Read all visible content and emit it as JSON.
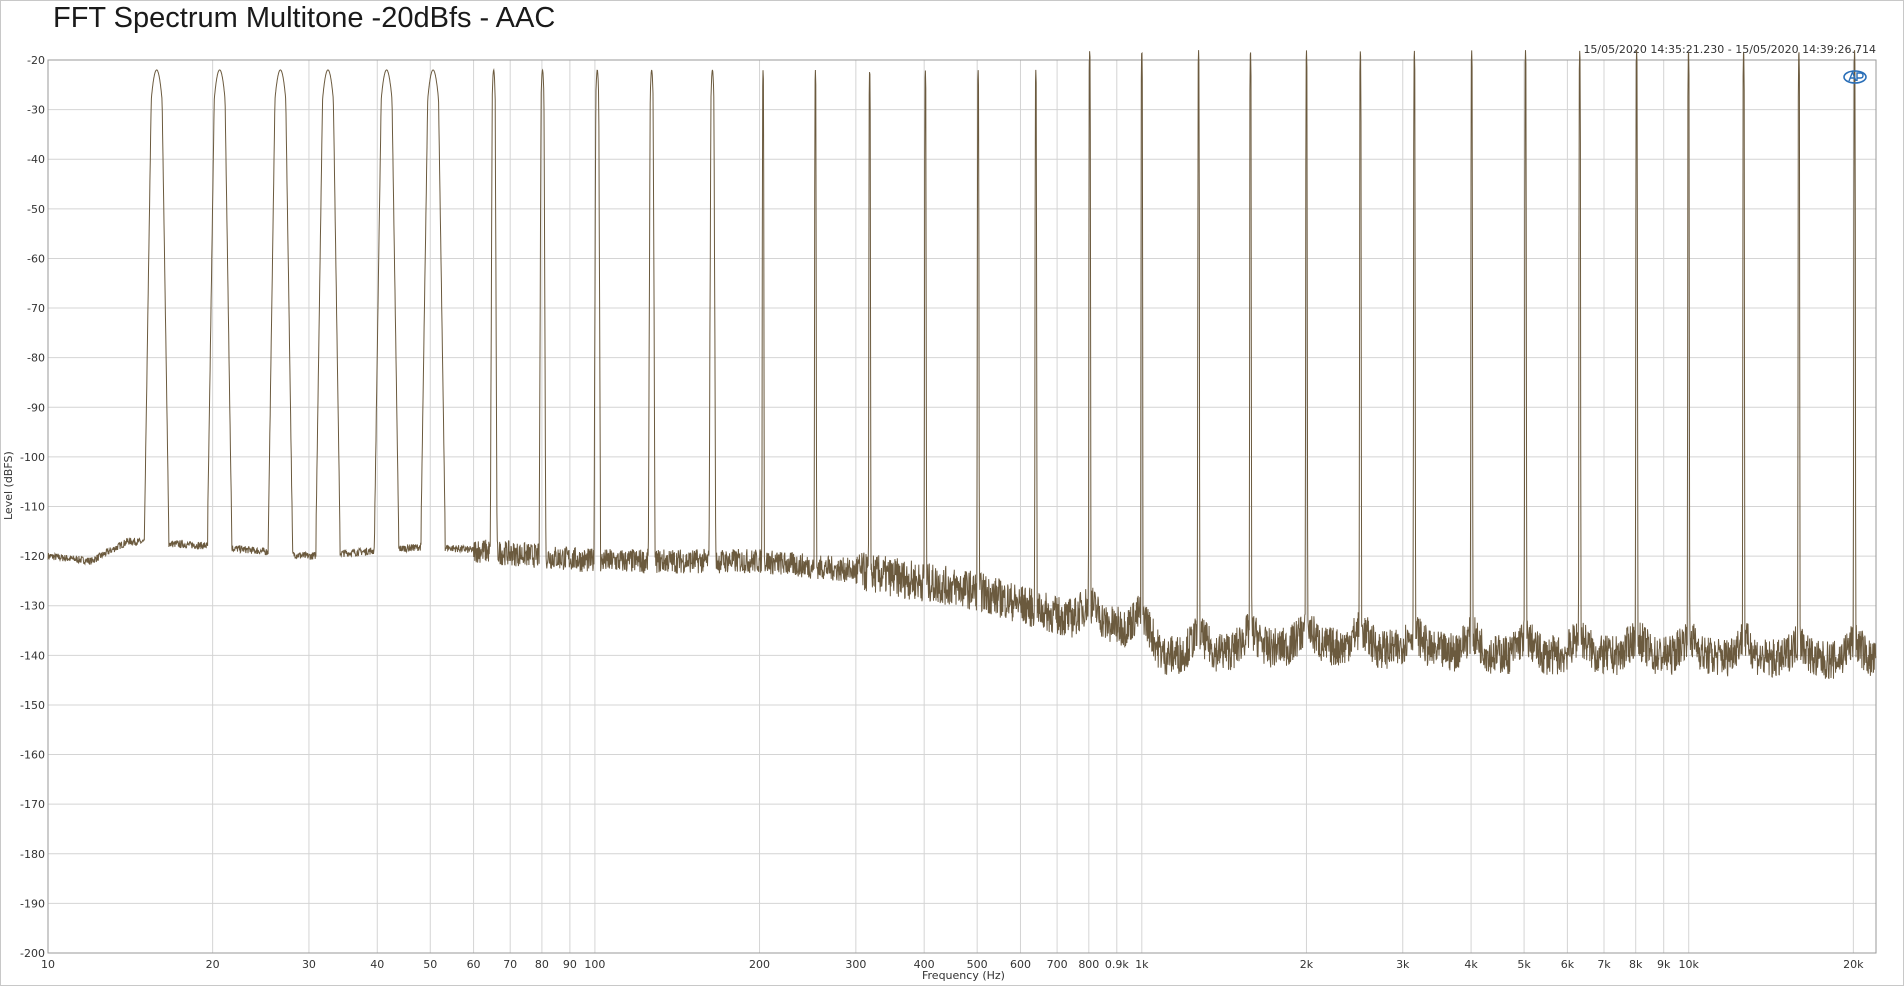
{
  "chart_data": {
    "type": "line",
    "title": "FFT Spectrum Multitone -20dBfs - AAC",
    "timestamp": "15/05/2020 14:35:21.230 - 15/05/2020 14:39:26.714",
    "xlabel": "Frequency (Hz)",
    "ylabel": "Level (dBFS)",
    "xscale": "log",
    "xlim": [
      10,
      22000
    ],
    "ylim": [
      -200,
      -20
    ],
    "grid": true,
    "line_color": "#6b5a3e",
    "x_ticks": [
      {
        "v": 10,
        "label": "10"
      },
      {
        "v": 20,
        "label": "20"
      },
      {
        "v": 30,
        "label": "30"
      },
      {
        "v": 40,
        "label": "40"
      },
      {
        "v": 50,
        "label": "50"
      },
      {
        "v": 60,
        "label": "60"
      },
      {
        "v": 70,
        "label": "70"
      },
      {
        "v": 80,
        "label": "80"
      },
      {
        "v": 90,
        "label": "90"
      },
      {
        "v": 100,
        "label": "100"
      },
      {
        "v": 200,
        "label": "200"
      },
      {
        "v": 300,
        "label": "300"
      },
      {
        "v": 400,
        "label": "400"
      },
      {
        "v": 500,
        "label": "500"
      },
      {
        "v": 600,
        "label": "600"
      },
      {
        "v": 700,
        "label": "700"
      },
      {
        "v": 800,
        "label": "800"
      },
      {
        "v": 900,
        "label": "0.9k"
      },
      {
        "v": 1000,
        "label": "1k"
      },
      {
        "v": 2000,
        "label": "2k"
      },
      {
        "v": 3000,
        "label": "3k"
      },
      {
        "v": 4000,
        "label": "4k"
      },
      {
        "v": 5000,
        "label": "5k"
      },
      {
        "v": 6000,
        "label": "6k"
      },
      {
        "v": 7000,
        "label": "7k"
      },
      {
        "v": 8000,
        "label": "8k"
      },
      {
        "v": 9000,
        "label": "9k"
      },
      {
        "v": 10000,
        "label": "10k"
      },
      {
        "v": 20000,
        "label": "20k"
      }
    ],
    "y_ticks": [
      -20,
      -30,
      -40,
      -50,
      -60,
      -70,
      -80,
      -90,
      -100,
      -110,
      -120,
      -130,
      -140,
      -150,
      -160,
      -170,
      -180,
      -190,
      -200
    ],
    "tones": [
      {
        "f": 15.8,
        "level": -22
      },
      {
        "f": 20.6,
        "level": -22
      },
      {
        "f": 26.6,
        "level": -22
      },
      {
        "f": 32.5,
        "level": -22
      },
      {
        "f": 41.6,
        "level": -22
      },
      {
        "f": 50.6,
        "level": -22
      },
      {
        "f": 65.3,
        "level": -22
      },
      {
        "f": 80.2,
        "level": -22
      },
      {
        "f": 101,
        "level": -22
      },
      {
        "f": 127,
        "level": -22
      },
      {
        "f": 164,
        "level": -22
      },
      {
        "f": 203,
        "level": -22
      },
      {
        "f": 253,
        "level": -22
      },
      {
        "f": 318,
        "level": -22
      },
      {
        "f": 402,
        "level": -22
      },
      {
        "f": 502,
        "level": -22
      },
      {
        "f": 640,
        "level": -22
      },
      {
        "f": 803,
        "level": -22
      },
      {
        "f": 1000,
        "level": -22
      },
      {
        "f": 1270,
        "level": -22
      },
      {
        "f": 1580,
        "level": -22
      },
      {
        "f": 2000,
        "level": -22
      },
      {
        "f": 2510,
        "level": -22
      },
      {
        "f": 3150,
        "level": -22
      },
      {
        "f": 4010,
        "level": -22
      },
      {
        "f": 5030,
        "level": -22
      },
      {
        "f": 6320,
        "level": -22
      },
      {
        "f": 8030,
        "level": -22
      },
      {
        "f": 9990,
        "level": -22
      },
      {
        "f": 12600,
        "level": -22
      },
      {
        "f": 15900,
        "level": -22
      },
      {
        "f": 20100,
        "level": -22
      }
    ],
    "noise_floor": [
      {
        "f": 10,
        "level": -120
      },
      {
        "f": 12,
        "level": -121
      },
      {
        "f": 14,
        "level": -117
      },
      {
        "f": 20,
        "level": -118
      },
      {
        "f": 30,
        "level": -120
      },
      {
        "f": 50,
        "level": -118
      },
      {
        "f": 100,
        "level": -121
      },
      {
        "f": 200,
        "level": -121
      },
      {
        "f": 300,
        "level": -123
      },
      {
        "f": 500,
        "level": -127
      },
      {
        "f": 700,
        "level": -132
      },
      {
        "f": 1000,
        "level": -135
      },
      {
        "f": 1100,
        "level": -140
      },
      {
        "f": 2000,
        "level": -138
      },
      {
        "f": 5000,
        "level": -140
      },
      {
        "f": 10000,
        "level": -140
      },
      {
        "f": 16000,
        "level": -141
      },
      {
        "f": 22000,
        "level": -141
      }
    ]
  }
}
